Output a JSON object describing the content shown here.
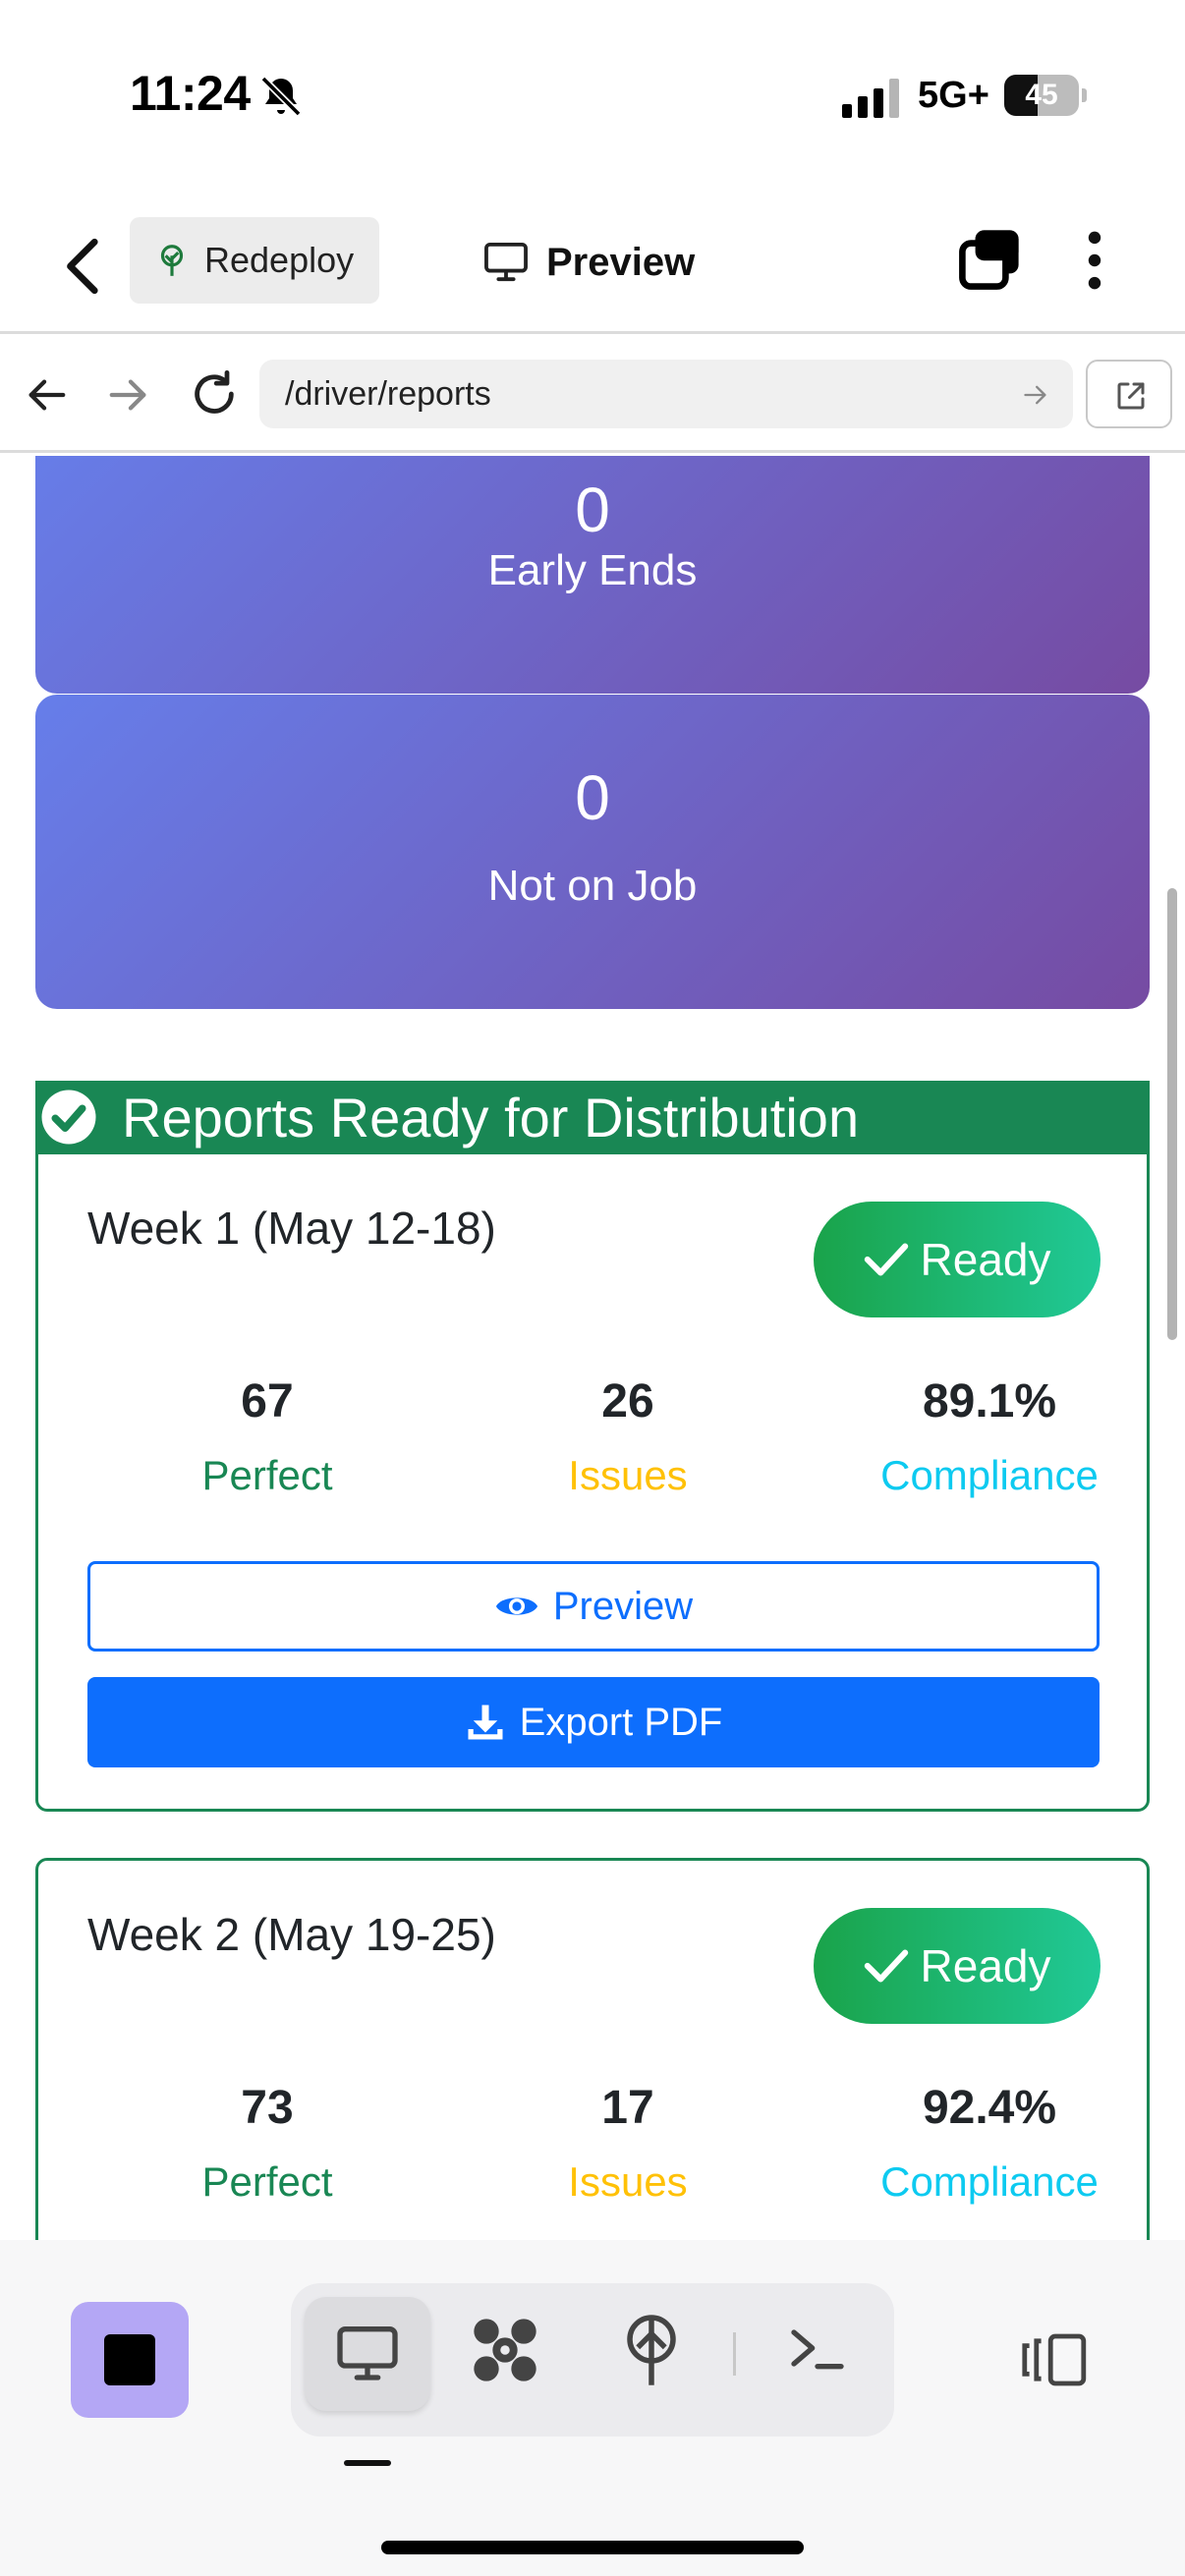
{
  "status_bar": {
    "time": "11:24",
    "network": "5G+",
    "battery_percent": "45",
    "battery_level": 0.45,
    "icons": [
      "bell-off-icon",
      "signal-icon",
      "battery-icon"
    ]
  },
  "header": {
    "back_icon": "chevron-left-icon",
    "project_label": "Redeploy",
    "project_icon": "tree-icon",
    "title": "Preview",
    "title_icon": "monitor-icon",
    "tabs_icon": "tabs-icon",
    "menu_icon": "kebab-icon"
  },
  "browser": {
    "url": "/driver/reports",
    "icons": [
      "arrow-left-icon",
      "arrow-right-icon",
      "reload-icon",
      "go-arrow-icon",
      "external-link-icon"
    ]
  },
  "stats": [
    {
      "value": "0",
      "label": "Early Ends"
    },
    {
      "value": "0",
      "label": "Not on Job"
    }
  ],
  "section": {
    "title": "Reports Ready for Distribution",
    "icon": "check-circle-icon",
    "color": "#198754"
  },
  "weeks": [
    {
      "title": "Week 1 (May 12-18)",
      "badge": "Ready",
      "perfect_value": "67",
      "perfect_label": "Perfect",
      "issues_value": "26",
      "issues_label": "Issues",
      "compliance_value": "89.1%",
      "compliance_label": "Compliance",
      "preview_label": "Preview",
      "export_label": "Export PDF"
    },
    {
      "title": "Week 2 (May 19-25)",
      "badge": "Ready",
      "perfect_value": "73",
      "perfect_label": "Perfect",
      "issues_value": "17",
      "issues_label": "Issues",
      "compliance_value": "92.4%",
      "compliance_label": "Compliance"
    }
  ],
  "colors": {
    "card_gradient_start": "#667eea",
    "card_gradient_end": "#764ba2",
    "primary": "#0d6efd",
    "success": "#198754",
    "warning": "#ffc107",
    "info": "#0dcaf0",
    "stop_button": "#b4a7f5"
  },
  "toolbar": {
    "icons": [
      "stop-icon",
      "desktop-icon",
      "apps-icon",
      "deploy-icon",
      "terminal-icon",
      "layout-toggle-icon"
    ],
    "active": "desktop-icon"
  }
}
